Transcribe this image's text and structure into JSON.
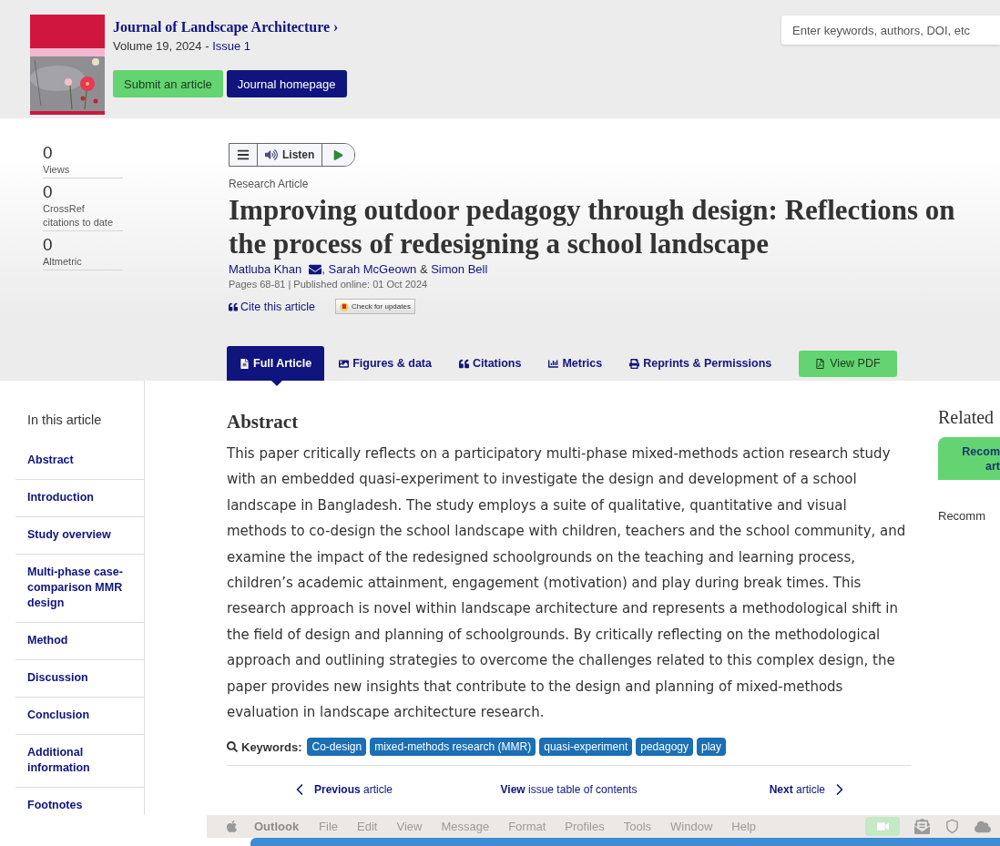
{
  "journal": {
    "title": "Journal of Landscape Architecture",
    "title_arrow": "›",
    "volume": "Volume 19, 2024 - ",
    "issue": "Issue 1",
    "buttons": [
      {
        "label": "Submit an article",
        "kind": "green"
      },
      {
        "label": "Journal homepage",
        "kind": "navy"
      }
    ]
  },
  "search": {
    "placeholder": "Enter keywords, authors, DOI, etc"
  },
  "stats": [
    {
      "value": "0",
      "label": "Views"
    },
    {
      "value": "0",
      "label": "CrossRef citations to date"
    },
    {
      "value": "0",
      "label": "Altmetric"
    }
  ],
  "listen": {
    "label": "Listen"
  },
  "article": {
    "type": "Research Article",
    "title": "Improving outdoor pedagogy through design: Reflections on the process of redesigning a school landscape",
    "authors": [
      {
        "name": "Matluba Khan",
        "email": true,
        "separator": ", "
      },
      {
        "name": "Sarah McGeown",
        "email": false,
        "separator": " & "
      },
      {
        "name": "Simon Bell",
        "email": false
      }
    ],
    "meta": "Pages 68-81 | Published online: 01 Oct 2024",
    "cite": "Cite this article",
    "updates": "Check for updates"
  },
  "tabs": [
    {
      "label": "Full Article",
      "kind": "tab",
      "selected": true
    },
    {
      "label": "Figures & data",
      "kind": "tab",
      "selected": false
    },
    {
      "label": "Citations",
      "kind": "tab",
      "selected": false
    },
    {
      "label": "Metrics",
      "kind": "tab",
      "selected": false
    },
    {
      "label": "Reprints & Permissions",
      "kind": "tab",
      "selected": false
    },
    {
      "label": "View PDF",
      "kind": "pdf",
      "selected": false
    }
  ],
  "toc": {
    "title": "In this article",
    "items": [
      "Abstract",
      "Introduction",
      "Study overview",
      "Multi-phase case-comparison MMR design",
      "Method",
      "Discussion",
      "Conclusion",
      "Additional information",
      "Footnotes"
    ]
  },
  "abstract": {
    "heading": "Abstract",
    "text": "This paper critically reflects on a participatory multi-phase mixed-methods action research study with an embedded quasi-experiment to investigate the design and development of a school landscape in Bangladesh. The study employs a suite of qualitative, quantitative and visual methods to co-design the school landscape with children, teachers and the school community, and examine the impact of the redesigned schoolgrounds on the teaching and learning process, children’s academic attainment, engagement (motivation) and play during break times. This research approach is novel within landscape architecture and represents a methodological shift in the field of design and planning of schoolgrounds. By critically reflecting on the methodological approach and outlining strategies to overcome the challenges related to this complex design, the paper provides new insights that contribute to the design and planning of mixed-methods evaluation in landscape architecture research."
  },
  "keywords": {
    "label": "Keywords:",
    "items": [
      "Co-design",
      "mixed-methods research (MMR)",
      "quasi-experiment",
      "pedagogy",
      "play"
    ]
  },
  "nav": {
    "previous": "**Previous** article",
    "issue": "**View** issue table of contents",
    "next": "**Next** article"
  },
  "related": {
    "heading": "Related",
    "button": [
      "Recom",
      "art"
    ],
    "text": "Recomm"
  },
  "menu_bar": {
    "app": "Outlook",
    "items": [
      "File",
      "Edit",
      "View",
      "Message",
      "Format",
      "Profiles",
      "Tools",
      "Window",
      "Help"
    ]
  }
}
